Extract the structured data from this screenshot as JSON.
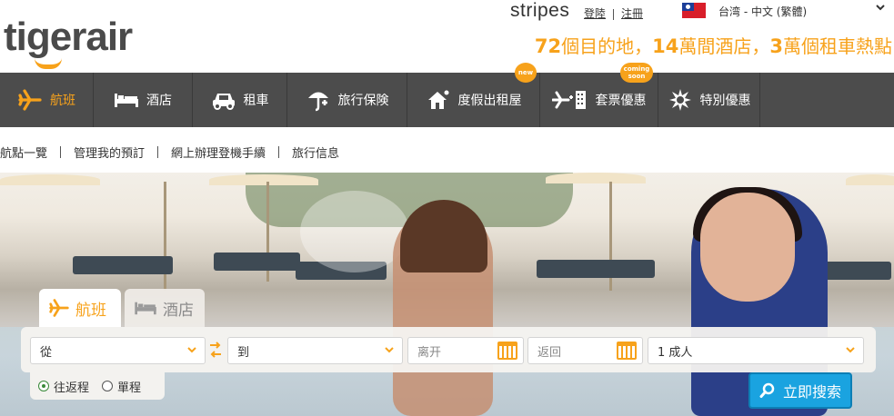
{
  "header": {
    "logo": "tigerair",
    "partner": "stripes",
    "login_label": "登陸",
    "register_label": "注冊",
    "language_label": "台湾 - 中文 (繁體)",
    "tagline": {
      "n1": "72",
      "t1": "個目的地，",
      "n2": "14",
      "t2": "萬間酒店，",
      "n3": "3",
      "t3": "萬個租車熱點"
    }
  },
  "nav": {
    "items": [
      {
        "label": "航班",
        "icon": "plane-icon"
      },
      {
        "label": "酒店",
        "icon": "bed-icon"
      },
      {
        "label": "租車",
        "icon": "car-icon"
      },
      {
        "label": "旅行保険",
        "icon": "umbrella-icon"
      },
      {
        "label": "度假出租屋",
        "icon": "house-icon",
        "badge": "new"
      },
      {
        "label": "套票優惠",
        "icon": "plane-hotel-icon",
        "badge_line1": "coming",
        "badge_line2": "soon"
      },
      {
        "label": "特別優惠",
        "icon": "star-burst-icon"
      }
    ]
  },
  "subnav": {
    "items": [
      "航點一覽",
      "管理我的預訂",
      "網上辦理登機手續",
      "旅行信息"
    ]
  },
  "search": {
    "tabs": [
      "航班",
      "酒店"
    ],
    "from_label": "從",
    "to_label": "到",
    "depart_placeholder": "离开",
    "return_placeholder": "返回",
    "passengers": "1 成人",
    "trip_types": [
      "往返程",
      "單程"
    ],
    "selected_trip": "往返程",
    "search_button": "立即搜索"
  },
  "colors": {
    "accent": "#f7a21b",
    "nav_bg": "#4c4c4c",
    "search_button": "#1aa3e0"
  }
}
